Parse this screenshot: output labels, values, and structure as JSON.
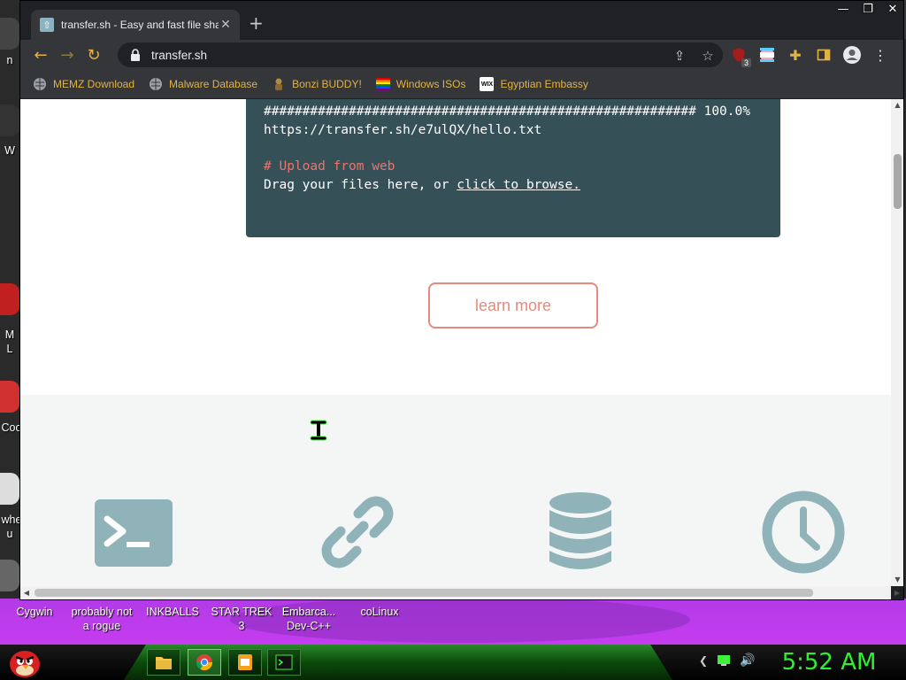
{
  "browser": {
    "tab_title": "transfer.sh - Easy and fast file sha",
    "url": "transfer.sh",
    "tab_close": "✕",
    "new_tab": "+",
    "window_controls": {
      "minimize": "—",
      "maximize": "❐",
      "close": "✕"
    },
    "extension_badge": "3"
  },
  "bookmarks": [
    {
      "label": "MEMZ Download",
      "icon": "globe-icon"
    },
    {
      "label": "Malware Database",
      "icon": "globe-icon"
    },
    {
      "label": "Bonzi BUDDY!",
      "icon": "bonzi-icon"
    },
    {
      "label": "Windows ISOs",
      "icon": "rainbow-flag-icon"
    },
    {
      "label": "Egyptian Embassy",
      "icon": "wix-icon"
    }
  ],
  "terminal": {
    "progress_line": "######################################################## 100.0%",
    "result_url": "https://transfer.sh/e7ulQX/hello.txt",
    "comment": "# Upload from web",
    "drag_text": "Drag your files here, or ",
    "browse_link": "click to browse."
  },
  "learn_more": "learn more",
  "feature_icons": [
    "terminal-icon",
    "link-icon",
    "database-icon",
    "clock-icon"
  ],
  "desktop_icons": [
    {
      "label": "Cygwin"
    },
    {
      "label": "probably not a rogue"
    },
    {
      "label": "INKBALLS"
    },
    {
      "label": "STAR TREK 3"
    },
    {
      "label": "Embarca... Dev-C++"
    },
    {
      "label": "coLinux"
    }
  ],
  "desktop_left_labels": [
    "n",
    "W",
    "M",
    "L",
    "Coo",
    "whe",
    "u"
  ],
  "taskbar": {
    "clock": "5:52 AM",
    "apps": [
      "file-explorer-icon",
      "chrome-icon",
      "slides-icon",
      "terminal-app-icon"
    ]
  },
  "colors": {
    "terminal_bg": "#355057",
    "accent_salmon": "#e58a7d",
    "feature_icon": "#8fb3b9",
    "clock_green": "#2ff02f"
  }
}
